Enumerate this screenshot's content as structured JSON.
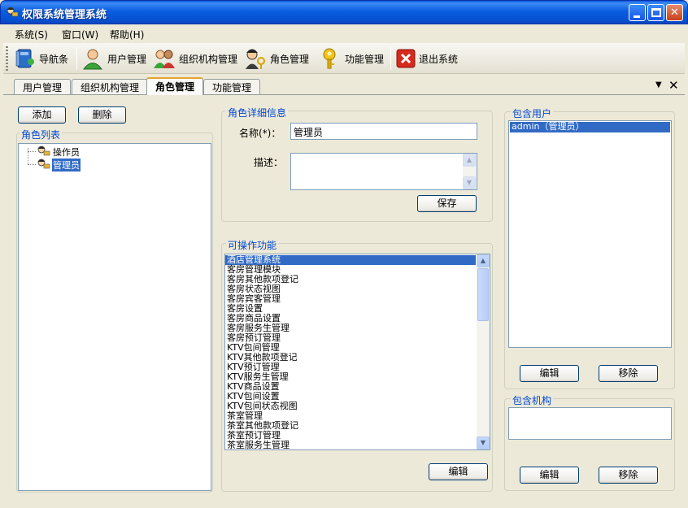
{
  "window": {
    "title": "权限系统管理系统"
  },
  "menu": [
    "系统(S)",
    "窗口(W)",
    "帮助(H)"
  ],
  "toolbar": {
    "nav": "导航条",
    "users": "用户管理",
    "orgs": "组织机构管理",
    "roles": "角色管理",
    "functions": "功能管理",
    "exit": "退出系统"
  },
  "tabs": [
    "用户管理",
    "组织机构管理",
    "角色管理",
    "功能管理"
  ],
  "tab_controls": {
    "menu": "▼",
    "close": "✕"
  },
  "left": {
    "add_label": "添加",
    "delete_label": "删除",
    "role_list_title": "角色列表",
    "roles": [
      "操作员",
      "管理员"
    ]
  },
  "detail": {
    "title": "角色详细信息",
    "name_label": "名称(*)：",
    "name_value": "管理员",
    "desc_label": "描述：",
    "desc_value": "",
    "save_label": "保存"
  },
  "functions": {
    "title": "可操作功能",
    "items": [
      "酒店管理系统",
      "客房管理模块",
      "客房其他款项登记",
      "客房状态视图",
      "客房宾客管理",
      "客房设置",
      "客房商品设置",
      "客房服务生管理",
      "客房预订管理",
      "KTV包间管理",
      "KTV其他款项登记",
      "KTV预订管理",
      "KTV服务生管理",
      "KTV商品设置",
      "KTV包间设置",
      "KTV包间状态视图",
      "茶室管理",
      "茶室其他款项登记",
      "茶室预订管理",
      "茶室服务生管理"
    ],
    "edit_label": "编辑"
  },
  "users": {
    "title": "包含用户",
    "items": [
      "admin（管理员）"
    ],
    "edit_label": "编辑",
    "remove_label": "移除"
  },
  "orgs": {
    "title": "包含机构",
    "items": [],
    "edit_label": "编辑",
    "remove_label": "移除"
  },
  "colors": {
    "accent": "#0046d5",
    "selection": "#316ac5",
    "titlebar": "#0653d4"
  }
}
